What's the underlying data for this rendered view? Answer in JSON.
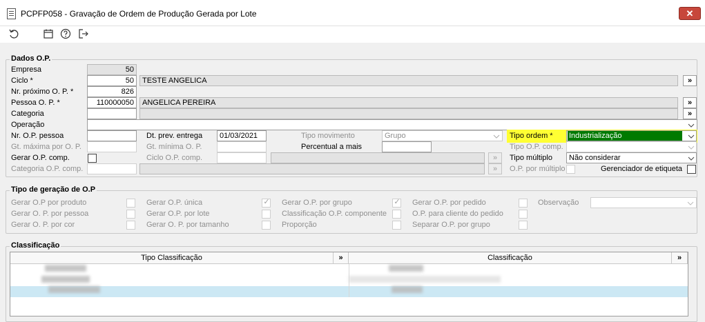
{
  "window": {
    "title": "PCPFP058 - Gravação de Ordem de Produção Gerada por Lote",
    "close_label": "✕"
  },
  "toolbar": {
    "icons": [
      "refresh-icon",
      "calendar-icon",
      "help-icon",
      "exit-icon"
    ]
  },
  "dados_op": {
    "legend": "Dados O.P.",
    "empresa": {
      "label": "Empresa",
      "value": "50"
    },
    "ciclo": {
      "label": "Ciclo *",
      "value": "50",
      "desc": "TESTE ANGELICA"
    },
    "nr_proximo": {
      "label": "Nr. próximo O. P. *",
      "value": "826"
    },
    "pessoa": {
      "label": "Pessoa O. P. *",
      "value": "110000050",
      "desc": "ANGELICA PEREIRA"
    },
    "categoria": {
      "label": "Categoria",
      "value": "",
      "desc": ""
    },
    "operacao": {
      "label": "Operação",
      "value": ""
    },
    "nr_op_pessoa": {
      "label": "Nr. O.P. pessoa",
      "value": ""
    },
    "gt_maxima": {
      "label": "Gt. máxima por O. P.",
      "value": ""
    },
    "gerar_op_comp": {
      "label": "Gerar O.P. comp.",
      "checked": false
    },
    "categoria_op_comp": {
      "label": "Categoria O.P. comp.",
      "value": ""
    },
    "dt_prev_entrega": {
      "label": "Dt. prev. entrega",
      "value": "01/03/2021"
    },
    "gt_minima": {
      "label": "Gt. mínima O. P.",
      "value": ""
    },
    "ciclo_op_comp": {
      "label": "Ciclo O.P. comp.",
      "value": ""
    },
    "tipo_movimento": {
      "label": "Tipo movimento",
      "value": "Grupo"
    },
    "percentual_a_mais": {
      "label": "Percentual a mais",
      "value": ""
    },
    "tipo_ordem": {
      "label": "Tipo ordem *",
      "value": "Industrialização"
    },
    "tipo_op_comp": {
      "label": "Tipo O.P. comp.",
      "value": ""
    },
    "tipo_multiplo": {
      "label": "Tipo múltiplo",
      "value": "Não considerar"
    },
    "op_por_multiplo": {
      "label": "O.P. por múltiplo",
      "checked": false
    },
    "gerenciador_etiqueta": {
      "label": "Gerenciador de etiqueta",
      "checked": false
    },
    "lookup_label": "»"
  },
  "tipo_geracao": {
    "legend": "Tipo de geração de O.P",
    "col1": [
      {
        "label": "Gerar O.P por produto",
        "checked": false
      },
      {
        "label": "Gerar O. P. por pessoa",
        "checked": false
      },
      {
        "label": "Gerar O. P. por cor",
        "checked": false
      }
    ],
    "col2": [
      {
        "label": "Gerar O.P. única",
        "checked": true
      },
      {
        "label": "Gerar O.P. por lote",
        "checked": false
      },
      {
        "label": "Gerar O. P. por tamanho",
        "checked": false
      }
    ],
    "col3": [
      {
        "label": "Gerar O.P. por grupo",
        "checked": true
      },
      {
        "label": "Classificação O.P. componente",
        "checked": false
      },
      {
        "label": "Proporção",
        "checked": false
      }
    ],
    "col4": [
      {
        "label": "Gerar O.P. por pedido",
        "checked": false
      },
      {
        "label": "O.P. para cliente do pedido",
        "checked": false
      },
      {
        "label": "Separar  O.P. por grupo",
        "checked": false
      }
    ],
    "observacao": {
      "label": "Observação",
      "value": ""
    }
  },
  "classificacao": {
    "legend": "Classificação",
    "columns": [
      "Tipo Classificação",
      "Classificação"
    ],
    "header_button": "»",
    "rows": 3
  },
  "colors": {
    "highlight_yellow": "#ffff33",
    "selected_green": "#007a00",
    "selected_row": "#cce8f4",
    "close_red": "#c7473b"
  }
}
